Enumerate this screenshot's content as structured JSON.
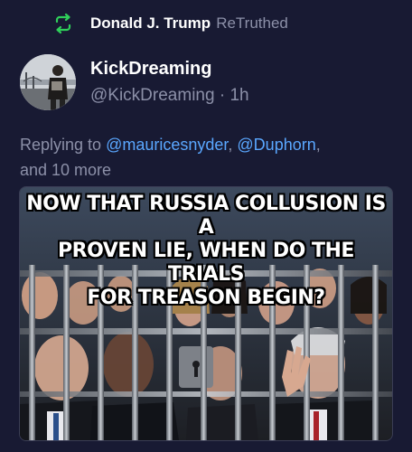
{
  "retruth": {
    "icon": "retruth-icon",
    "name": "Donald J. Trump",
    "verb": "ReTruthed",
    "accent": "#2fcf5a"
  },
  "post": {
    "author_name": "KickDreaming",
    "author_handle": "@KickDreaming",
    "separator": " · ",
    "time": "1h",
    "replying_prefix": "Replying to ",
    "mentions": [
      "@mauricesnyder",
      "@Duphorn"
    ],
    "mention_separator": ", ",
    "replying_suffix": ",",
    "replying_more": "and 10 more",
    "mention_color": "#5aa7ff"
  },
  "media": {
    "meme_lines": [
      "NOW THAT RUSSIA COLLUSION IS A",
      "PROVEN LIE, WHEN DO THE TRIALS",
      "FOR TREASON BEGIN?"
    ]
  }
}
